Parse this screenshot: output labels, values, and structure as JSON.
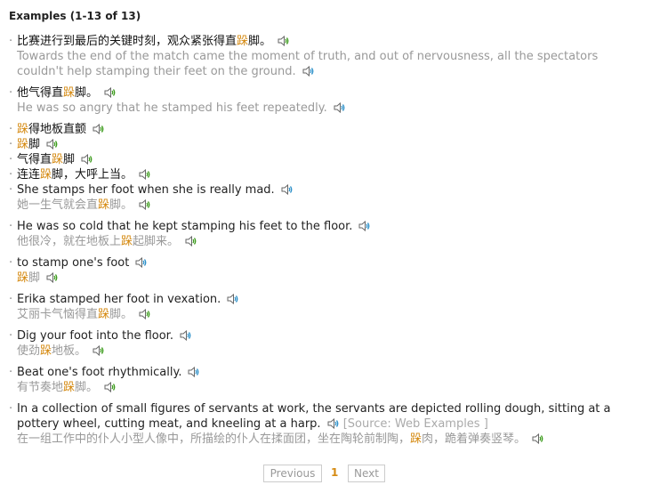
{
  "header": {
    "title": "Examples (1-13 of 13)"
  },
  "highlight_char": "跺",
  "colors": {
    "highlight": "#d58a12",
    "gray_text": "#999999",
    "speaker_zh": "#3a9a1a",
    "speaker_en": "#2a8fc8"
  },
  "icons": {
    "speaker_zh": "speaker-green-icon",
    "speaker_en": "speaker-blue-icon"
  },
  "examples": [
    {
      "zh": "比赛进行到最后的关键时刻，观众紧张得直跺脚。",
      "en": "Towards the end of the match came the moment of truth, and out of nervousness, all the spectators couldn't help stamping their feet on the ground."
    },
    {
      "zh": "他气得直跺脚。",
      "en": "He was so angry that he stamped his feet repeatedly."
    },
    {
      "zh": "跺得地板直颤"
    },
    {
      "zh": "跺脚"
    },
    {
      "zh": "气得直跺脚"
    },
    {
      "zh": "连连跺脚，大呼上当。"
    },
    {
      "en": "She stamps her foot when she is really mad.",
      "zh": "她一生气就会直跺脚。"
    },
    {
      "en": "He was so cold that he kept stamping his feet to the floor.",
      "zh": "他很冷，就在地板上跺起脚来。"
    },
    {
      "en": "to stamp one's foot",
      "zh": "跺脚"
    },
    {
      "en": "Erika stamped her foot in vexation.",
      "zh": "艾丽卡气恼得直跺脚。"
    },
    {
      "en": "Dig your foot into the floor.",
      "zh": "使劲跺地板。"
    },
    {
      "en": "Beat one's foot rhythmically.",
      "zh": "有节奏地跺脚。"
    },
    {
      "en": "In a collection of small figures of servants at work, the servants are depicted rolling dough, sitting at a pottery wheel, cutting meat, and kneeling at a harp.",
      "source": "[Source: Web Examples ]",
      "zh": "在一组工作中的仆人小型人像中，所描绘的仆人在揉面团，坐在陶轮前制陶，跺肉，跪着弹奏竖琴。"
    }
  ],
  "pagination": {
    "prev_label": "Previous",
    "current": "1",
    "next_label": "Next"
  }
}
